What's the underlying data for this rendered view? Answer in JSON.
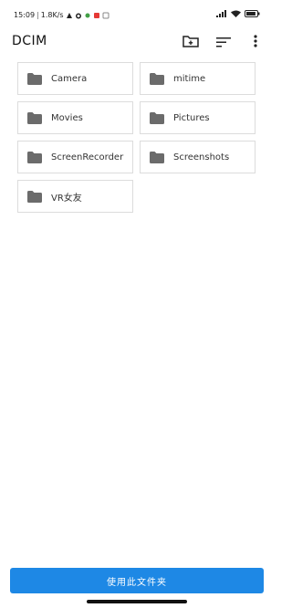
{
  "status_bar": {
    "time": "15:09",
    "separator": "|",
    "network_speed": "1.8K/s",
    "battery_level": 0.9
  },
  "header": {
    "title": "DCIM",
    "icons": [
      "new-folder-icon",
      "sort-icon",
      "more-vert-icon"
    ]
  },
  "folders": [
    {
      "label": "Camera"
    },
    {
      "label": "mitime"
    },
    {
      "label": "Movies"
    },
    {
      "label": "Pictures"
    },
    {
      "label": "ScreenRecorder"
    },
    {
      "label": "Screenshots"
    },
    {
      "label": "VR女友"
    }
  ],
  "footer": {
    "use_folder_label": "使用此文件夹"
  },
  "colors": {
    "accent": "#1e88e5",
    "folder_icon": "#6b6b6b",
    "border": "#dcdcdc"
  }
}
